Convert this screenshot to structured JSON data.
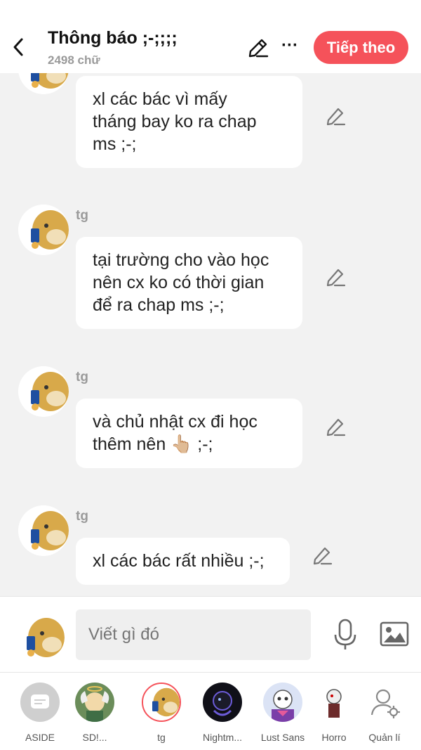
{
  "header": {
    "title": "Thông báo ;-;;;;",
    "word_count": "2498 chữ",
    "more_label": "···",
    "next_label": "Tiếp theo",
    "accent": "#f5525a"
  },
  "messages": [
    {
      "author": "",
      "lines": [
        "xl các bác vì mấy",
        "tháng bay ko ra chap",
        "ms ;-;"
      ]
    },
    {
      "author": "tg",
      "lines": [
        "tại trường cho vào học",
        "nên cx ko có thời gian",
        "để ra chap ms ;-;"
      ]
    },
    {
      "author": "tg",
      "lines": [
        "và chủ nhật cx đi học",
        "thêm nên 👆🏼 ;-;"
      ]
    },
    {
      "author": "tg",
      "lines": [
        "xl các bác rất nhiều ;-;"
      ]
    }
  ],
  "composer": {
    "placeholder": "Viết gì đó",
    "mic_icon": "microphone-icon",
    "image_icon": "image-icon"
  },
  "characters": [
    {
      "name": "ASIDE"
    },
    {
      "name": "SD!..."
    },
    {
      "name": "tg"
    },
    {
      "name": "Nightm..."
    },
    {
      "name": "Lust Sans"
    },
    {
      "name": "Horro"
    },
    {
      "name": "Quản lí"
    }
  ]
}
